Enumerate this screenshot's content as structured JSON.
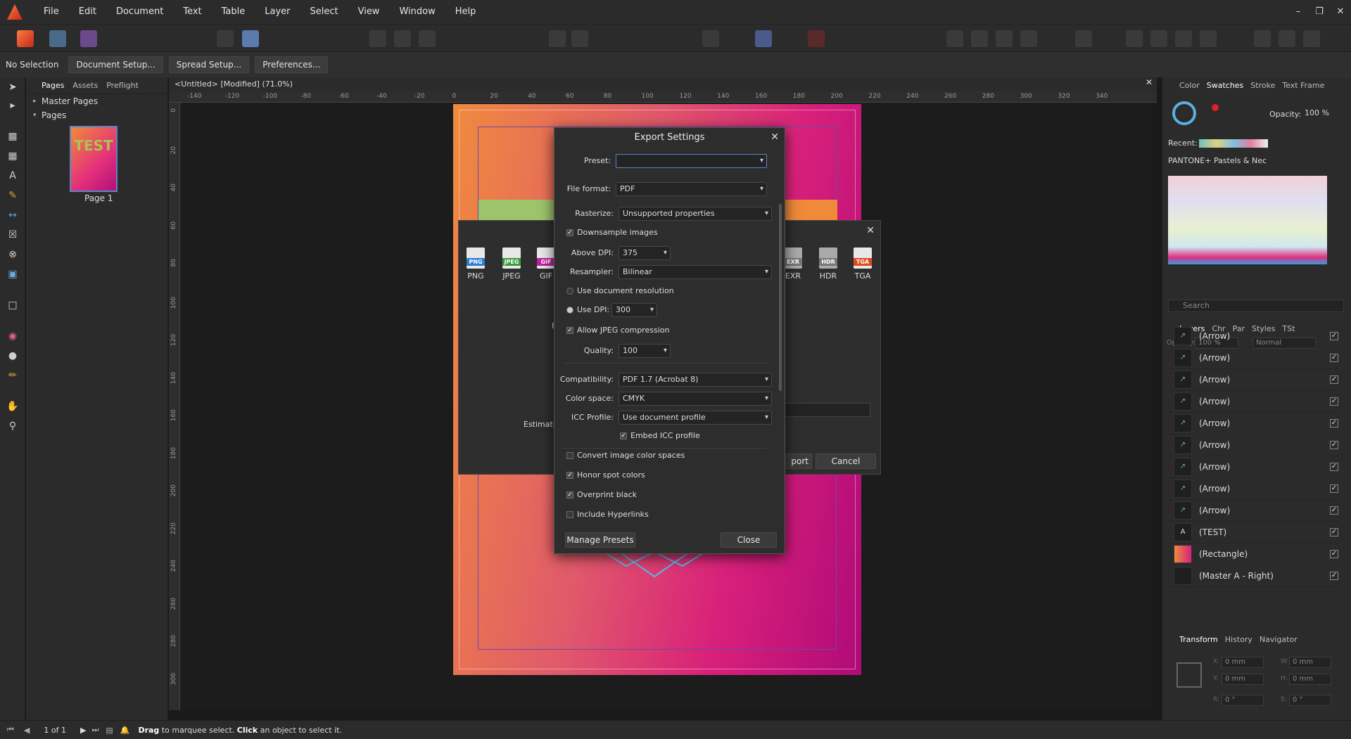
{
  "menubar": {
    "items": [
      "File",
      "Edit",
      "Document",
      "Text",
      "Table",
      "Layer",
      "Select",
      "View",
      "Window",
      "Help"
    ]
  },
  "context": {
    "selection": "No Selection",
    "buttons": [
      "Document Setup...",
      "Spread Setup...",
      "Preferences..."
    ]
  },
  "pages_panel": {
    "tabs": [
      "Pages",
      "Assets",
      "Preflight"
    ],
    "master_pages": "Master Pages",
    "pages": "Pages",
    "page_label": "Page 1",
    "thumb_text": "TEST"
  },
  "document": {
    "tab_title": "<Untitled> [Modified] (71.0%)",
    "ruler_h": [
      "-140",
      "-120",
      "-100",
      "-80",
      "-60",
      "-40",
      "-20",
      "0",
      "20",
      "40",
      "60",
      "80",
      "100",
      "120",
      "140",
      "160",
      "180",
      "200",
      "220",
      "240",
      "260",
      "280",
      "300",
      "320",
      "340"
    ],
    "ruler_v": [
      "0",
      "20",
      "40",
      "60",
      "80",
      "100",
      "120",
      "140",
      "160",
      "180",
      "200",
      "220",
      "240",
      "260",
      "280",
      "300"
    ]
  },
  "export_bg": {
    "formats": [
      {
        "name": "PNG",
        "color": "#2a7fd0"
      },
      {
        "name": "JPEG",
        "color": "#3a9a3a"
      },
      {
        "name": "GIF",
        "color": "#c020a0"
      },
      {
        "name": "EXR",
        "color": "#777777"
      },
      {
        "name": "HDR",
        "color": "#777777"
      },
      {
        "name": "TGA",
        "color": "#e04a20"
      }
    ],
    "estimate": "Estimate",
    "export_partial": "port",
    "cancel": "Cancel",
    "partial_letter": "F"
  },
  "dialog": {
    "title": "Export Settings",
    "preset_label": "Preset:",
    "preset_value": "",
    "file_format_label": "File format:",
    "file_format": "PDF",
    "rasterize_label": "Rasterize:",
    "rasterize": "Unsupported properties",
    "downsample": "Downsample images",
    "above_dpi_label": "Above DPI:",
    "above_dpi": "375",
    "resampler_label": "Resampler:",
    "resampler": "Bilinear",
    "use_doc_res": "Use document resolution",
    "use_dpi_label": "Use DPI:",
    "use_dpi": "300",
    "allow_jpeg": "Allow JPEG compression",
    "quality_label": "Quality:",
    "quality": "100",
    "compat_label": "Compatibility:",
    "compat": "PDF 1.7 (Acrobat 8)",
    "colorspace_label": "Color space:",
    "colorspace": "CMYK",
    "icc_label": "ICC Profile:",
    "icc": "Use document profile",
    "embed_icc": "Embed ICC profile",
    "convert_cs": "Convert image color spaces",
    "honor_spot": "Honor spot colors",
    "overprint": "Overprint black",
    "hyperlinks": "Include Hyperlinks",
    "manage": "Manage Presets",
    "close": "Close"
  },
  "right_panel": {
    "top_tabs": [
      "Color",
      "Swatches",
      "Stroke",
      "Text Frame"
    ],
    "opacity_label": "Opacity:",
    "opacity": "100 %",
    "recent_label": "Recent:",
    "palette": "PANTONE+ Pastels & Nec",
    "search_placeholder": "Search",
    "layer_tabs": [
      "Layers",
      "Chr",
      "Par",
      "Styles",
      "TSt"
    ],
    "layer_opacity_label": "Opacity:",
    "layer_opacity": "100 %",
    "blend": "Normal",
    "layers": [
      "(Arrow)",
      "(Arrow)",
      "(Arrow)",
      "(Arrow)",
      "(Arrow)",
      "(Arrow)",
      "(Arrow)",
      "(Arrow)",
      "(Arrow)",
      "(TEST)",
      "(Rectangle)",
      "(Master A - Right)"
    ],
    "bottom_tabs": [
      "Transform",
      "History",
      "Navigator"
    ],
    "transform": {
      "x_label": "X:",
      "x": "0 mm",
      "y_label": "Y:",
      "y": "0 mm",
      "w_label": "W:",
      "w": "0 mm",
      "h_label": "H:",
      "h": "0 mm",
      "r_label": "R:",
      "r": "0 °",
      "s_label": "S:",
      "s": "0 °"
    }
  },
  "status": {
    "page_count": "1 of 1",
    "drag": "Drag",
    "drag_text": " to marquee select. ",
    "click": "Click",
    "click_text": " an object to select it."
  }
}
